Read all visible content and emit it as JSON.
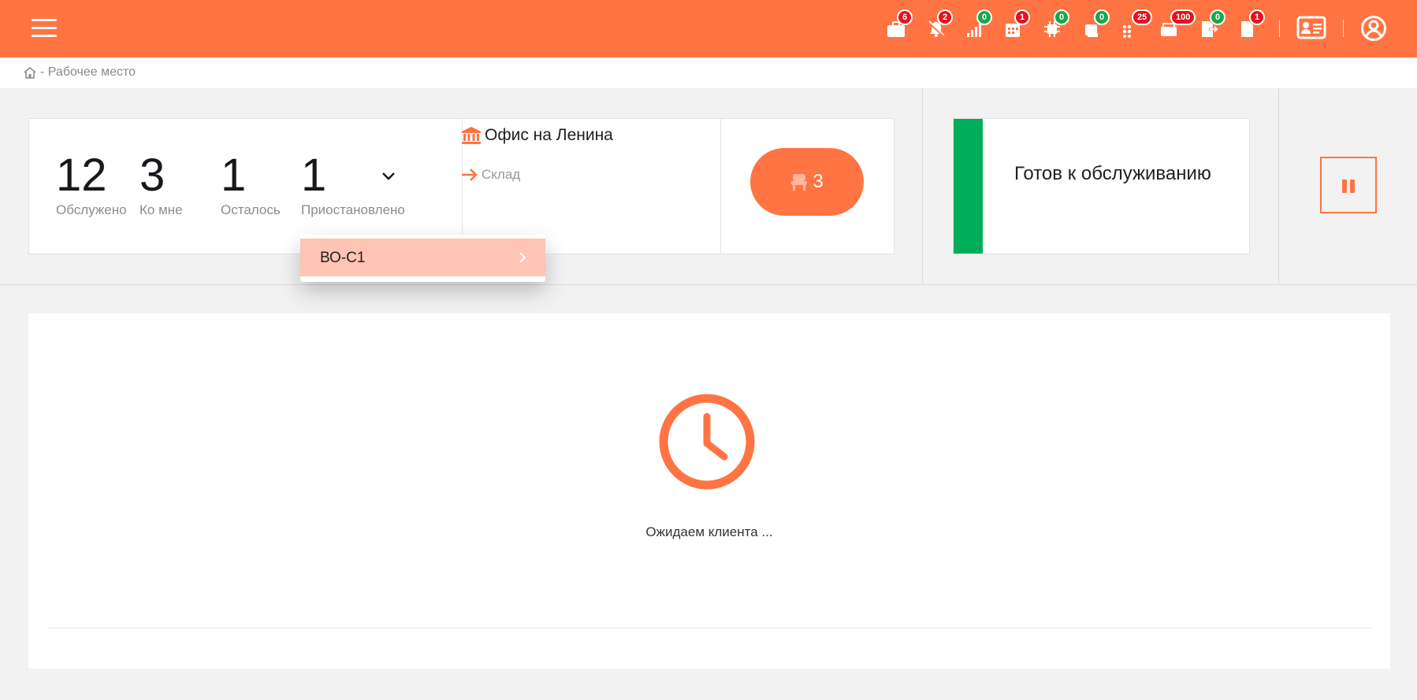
{
  "colors": {
    "accent": "#ff7442",
    "badge_red": "#e3121e",
    "badge_green": "#1aa64a",
    "status_ready": "#00ae5a",
    "dropdown_highlight": "#ffc4b3"
  },
  "topbar": {
    "menu_icon": "hamburger-menu-icon",
    "badges": [
      {
        "icon": "briefcase-icon",
        "count": "6",
        "color": "red"
      },
      {
        "icon": "bell-off-icon",
        "count": "2",
        "color": "red"
      },
      {
        "icon": "signal-bars-icon",
        "count": "0",
        "color": "green"
      },
      {
        "icon": "calendar-icon",
        "count": "1",
        "color": "red"
      },
      {
        "icon": "chip-icon",
        "count": "0",
        "color": "green"
      },
      {
        "icon": "printer-icon",
        "count": "0",
        "color": "green"
      },
      {
        "icon": "grid-icon",
        "count": "25",
        "color": "red"
      },
      {
        "icon": "inbox-icon",
        "count": "100",
        "color": "red"
      },
      {
        "icon": "file-export-icon",
        "count": "0",
        "color": "green"
      },
      {
        "icon": "file-icon",
        "count": "1",
        "color": "red"
      }
    ],
    "profile_card_icon": "id-card-icon",
    "user_icon": "user-circle-icon"
  },
  "breadcrumb": {
    "home_icon": "home-icon",
    "text": "- Рабочее место"
  },
  "stats": [
    {
      "value": "12",
      "label": "Обслужено"
    },
    {
      "value": "3",
      "label": "Ко мне"
    },
    {
      "value": "1",
      "label": "Осталось"
    },
    {
      "value": "1",
      "label": "Приостановлено"
    }
  ],
  "office": {
    "name": "Офис на Ленина",
    "link": "Склад"
  },
  "queue_button": {
    "icon": "chair-icon",
    "count": "3"
  },
  "status": {
    "text": "Готов к обслуживанию"
  },
  "dropdown": {
    "items": [
      {
        "label": "ВО-С1"
      }
    ]
  },
  "main": {
    "icon": "clock-icon",
    "waiting_text": "Ожидаем клиента ..."
  }
}
